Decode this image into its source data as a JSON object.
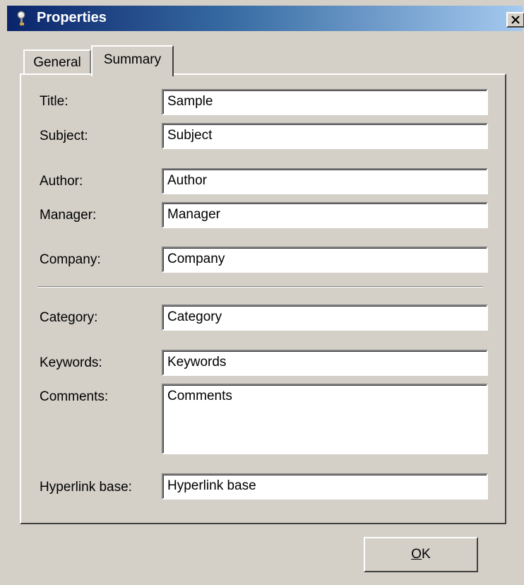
{
  "window": {
    "title": "Properties",
    "icon": "properties-pin-icon",
    "close_icon": "close-icon"
  },
  "tabs": [
    {
      "label": "General",
      "active": false
    },
    {
      "label": "Summary",
      "active": true
    }
  ],
  "fields": {
    "title": {
      "label": "Title:",
      "value": "Sample"
    },
    "subject": {
      "label": "Subject:",
      "value": "Subject"
    },
    "author": {
      "label": "Author:",
      "value": "Author"
    },
    "manager": {
      "label": "Manager:",
      "value": "Manager"
    },
    "company": {
      "label": "Company:",
      "value": "Company"
    },
    "category": {
      "label": "Category:",
      "value": "Category"
    },
    "keywords": {
      "label": "Keywords:",
      "value": "Keywords"
    },
    "comments": {
      "label": "Comments:",
      "value": "Comments"
    },
    "hyperlink_base": {
      "label": "Hyperlink base:",
      "value": "Hyperlink base"
    }
  },
  "buttons": {
    "ok_mnemonic": "O",
    "ok_rest": "K"
  }
}
